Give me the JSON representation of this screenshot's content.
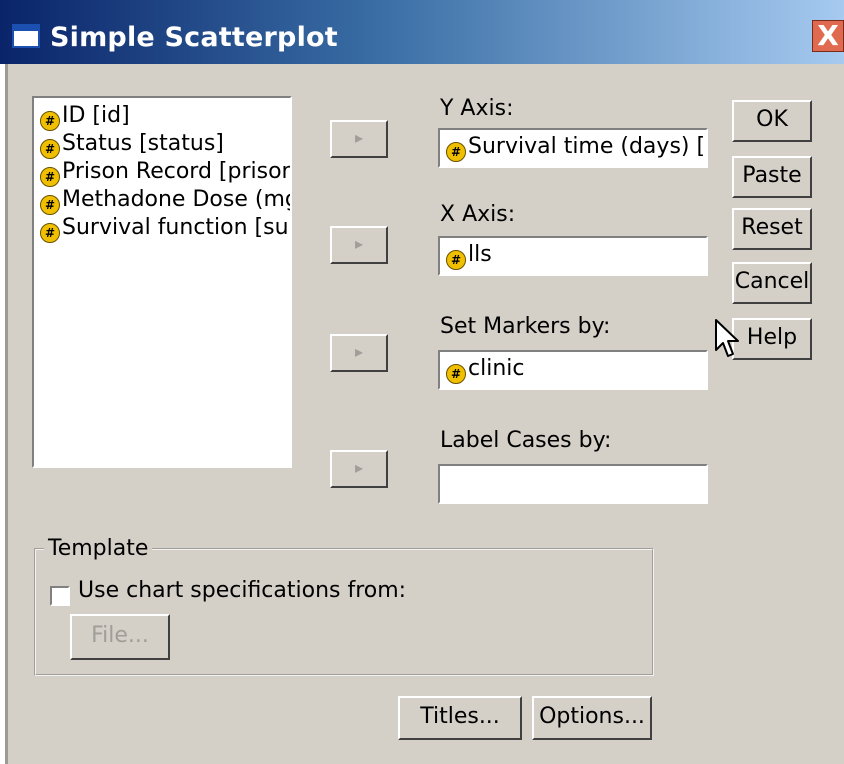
{
  "window": {
    "title": "Simple Scatterplot",
    "close_glyph": "X"
  },
  "variables": [
    {
      "label": "ID [id]",
      "icon": "scale-variable-icon"
    },
    {
      "label": "Status [status]",
      "icon": "scale-variable-icon"
    },
    {
      "label": "Prison Record [prison]",
      "icon": "scale-variable-icon"
    },
    {
      "label": "Methadone Dose (mg/",
      "icon": "scale-variable-icon"
    },
    {
      "label": "Survival function [sur_",
      "icon": "scale-variable-icon"
    }
  ],
  "fields": {
    "y_axis": {
      "label": "Y Axis:",
      "value": "Survival time (days) [s"
    },
    "x_axis": {
      "label": "X Axis:",
      "value": "lls"
    },
    "markers": {
      "label": "Set Markers by:",
      "value": "clinic"
    },
    "label_cases": {
      "label": "Label Cases by:",
      "value": ""
    }
  },
  "arrow_glyph": "▸",
  "var_icon_glyph": "#",
  "buttons": {
    "ok": "OK",
    "paste": "Paste",
    "reset": "Reset",
    "cancel": "Cancel",
    "help": "Help"
  },
  "template": {
    "title": "Template",
    "checkbox_label": "Use chart specifications from:",
    "checked": false,
    "file_button": "File..."
  },
  "bottom": {
    "titles": "Titles...",
    "options": "Options..."
  }
}
